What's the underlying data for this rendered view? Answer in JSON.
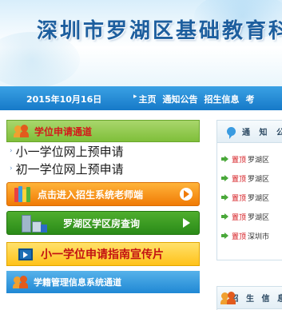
{
  "header": {
    "title": "深圳市罗湖区基础教育科"
  },
  "nav": {
    "date": "2015年10月16日",
    "links": [
      {
        "label": "主页",
        "arrow": "▸"
      },
      {
        "label": "通知公告"
      },
      {
        "label": "招生信息"
      },
      {
        "label": "考"
      }
    ]
  },
  "left": {
    "section_title": "学位申请通道",
    "links": [
      {
        "bullet": "›",
        "label": "小一学位网上预申请"
      },
      {
        "bullet": "›",
        "label": "初一学位网上预申请"
      }
    ],
    "teacher_button": "点击进入招生系统老师端",
    "house_button": "罗湖区学区房查询",
    "guide_button": "小一学位申请指南宣传片",
    "mgmt_section_title": "学籍管理信息系统通道"
  },
  "right": {
    "notice_title": "通 知 公",
    "notices": [
      {
        "tag": "置顶",
        "text": "罗湖区"
      },
      {
        "tag": "置顶",
        "text": "罗湖区"
      },
      {
        "tag": "置顶",
        "text": "罗湖区"
      },
      {
        "tag": "置顶",
        "text": "罗湖区"
      },
      {
        "tag": "置顶",
        "text": "深圳市"
      }
    ],
    "admission_title": "招 生 信 息"
  },
  "colors": {
    "nav_blue": "#1679c8",
    "title_blue": "#1d5e9e",
    "section_green": "#7fbf3a",
    "alert_red": "#d4141a",
    "orange": "#f07a05"
  }
}
